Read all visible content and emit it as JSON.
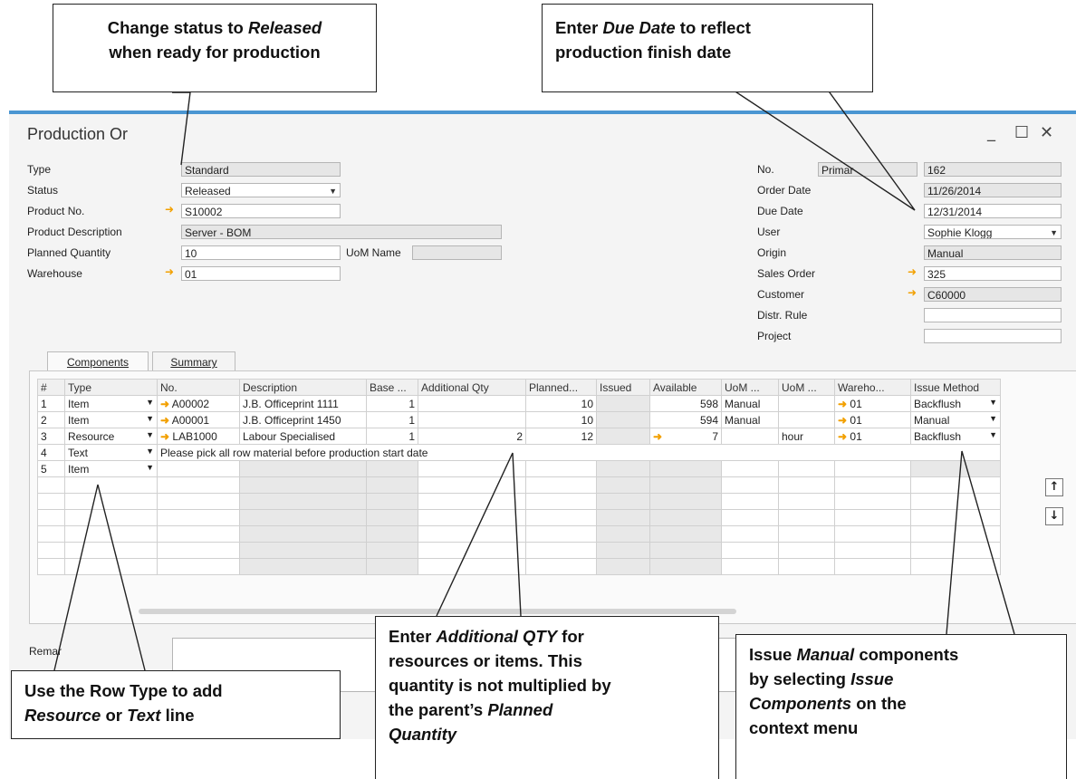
{
  "window": {
    "title": "Production Or",
    "controls": {
      "minimize": "_",
      "maximize": "☐",
      "close": "✕"
    }
  },
  "header_left": {
    "type_label": "Type",
    "type_value": "Standard",
    "status_label": "Status",
    "status_value": "Released",
    "product_no_label": "Product No.",
    "product_no_value": "S10002",
    "product_desc_label": "Product Description",
    "product_desc_value": "Server - BOM",
    "planned_qty_label": "Planned Quantity",
    "planned_qty_value": "10",
    "uom_name_label": "UoM Name",
    "uom_name_value": "",
    "warehouse_label": "Warehouse",
    "warehouse_value": "01"
  },
  "header_right": {
    "no_label": "No.",
    "series_value": "Primar",
    "no_value": "162",
    "order_date_label": "Order Date",
    "order_date_value": "11/26/2014",
    "due_date_label": "Due Date",
    "due_date_value": "12/31/2014",
    "user_label": "User",
    "user_value": "Sophie Klogg",
    "origin_label": "Origin",
    "origin_value": "Manual",
    "sales_order_label": "Sales Order",
    "sales_order_value": "325",
    "customer_label": "Customer",
    "customer_value": "C60000",
    "distr_rule_label": "Distr. Rule",
    "distr_rule_value": "",
    "project_label": "Project",
    "project_value": ""
  },
  "tabs": [
    {
      "label": "Components"
    },
    {
      "label": "Summary"
    }
  ],
  "grid": {
    "columns": [
      "#",
      "Type",
      "No.",
      "Description",
      "Base ...",
      "Additional Qty",
      "Planned...",
      "Issued",
      "Available",
      "UoM ...",
      "UoM ...",
      "Wareho...",
      "Issue Method"
    ],
    "rows": [
      {
        "n": "1",
        "type": "Item",
        "no": "A00002",
        "desc": "J.B. Officeprint 1111",
        "base": "1",
        "addl": "",
        "planned": "10",
        "issued": "",
        "avail": "598",
        "uom1": "Manual",
        "uom2": "",
        "wh": "01",
        "method": "Backflush"
      },
      {
        "n": "2",
        "type": "Item",
        "no": "A00001",
        "desc": "J.B. Officeprint 1450",
        "base": "1",
        "addl": "",
        "planned": "10",
        "issued": "",
        "avail": "594",
        "uom1": "Manual",
        "uom2": "",
        "wh": "01",
        "method": "Manual"
      },
      {
        "n": "3",
        "type": "Resource",
        "no": "LAB1000",
        "desc": "Labour Specialised",
        "base": "1",
        "addl": "2",
        "planned": "12",
        "issued": "",
        "avail": "7",
        "uom1": "",
        "uom2": "hour",
        "wh": "01",
        "method": "Backflush"
      },
      {
        "n": "4",
        "type": "Text",
        "text": "Please pick all row material before production start date"
      },
      {
        "n": "5",
        "type": "Item"
      }
    ]
  },
  "remarks_label": "Remar",
  "callouts": {
    "status": [
      "Change status to ",
      "Released",
      "when ready for production"
    ],
    "due_date": [
      "Enter ",
      "Due Date",
      " to reflect",
      "production finish date"
    ],
    "row_type": [
      "Use the Row Type to add",
      "Resource",
      " or ",
      "Text",
      " line"
    ],
    "additional": [
      "Enter ",
      "Additional QTY",
      " for",
      "resources or items.  This",
      "quantity is not multiplied by",
      "the parent’s ",
      "Planned",
      "Quantity"
    ],
    "issue": [
      "Issue ",
      "Manual",
      " components",
      "by selecting ",
      "Issue",
      "Components",
      " on the",
      "context menu"
    ]
  },
  "colors": {
    "accent": "#4a96d2",
    "link_arrow": "#f2a000",
    "readonly": "#e6e6e6"
  },
  "icons": [
    "link-arrow-icon",
    "dropdown-icon",
    "move-up-icon",
    "move-down-icon",
    "minimize-icon",
    "maximize-icon",
    "close-icon"
  ]
}
